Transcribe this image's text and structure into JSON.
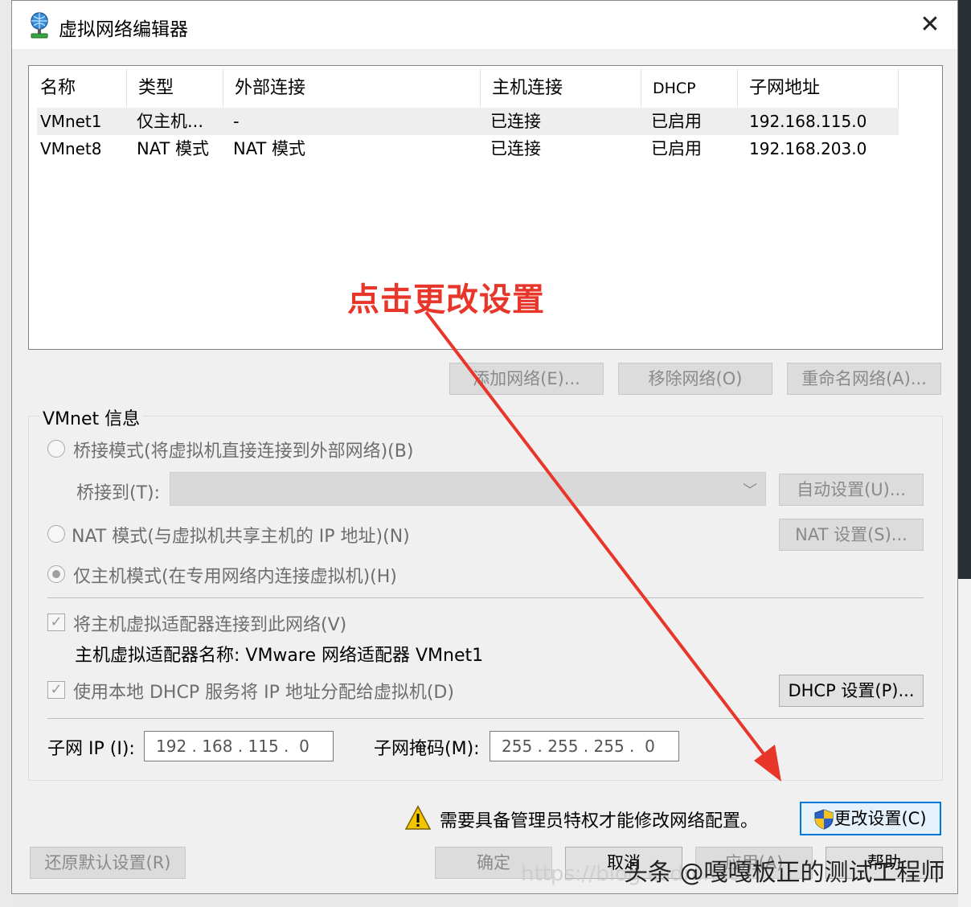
{
  "window": {
    "title": "虚拟网络编辑器",
    "close_glyph": "✕"
  },
  "table": {
    "headers": [
      "名称",
      "类型",
      "外部连接",
      "主机连接",
      "DHCP",
      "子网地址"
    ],
    "rows": [
      [
        "VMnet1",
        "仅主机...",
        "-",
        "已连接",
        "已启用",
        "192.168.115.0"
      ],
      [
        "VMnet8",
        "NAT 模式",
        "NAT 模式",
        "已连接",
        "已启用",
        "192.168.203.0"
      ]
    ]
  },
  "network_buttons": {
    "add": "添加网络(E)...",
    "remove": "移除网络(O)",
    "rename": "重命名网络(A)..."
  },
  "vmnet_info": {
    "group_label": "VMnet 信息",
    "bridged_mode": "桥接模式(将虚拟机直接连接到外部网络)(B)",
    "bridged_to_label": "桥接到(T):",
    "auto_settings": "自动设置(U)...",
    "nat_mode": "NAT 模式(与虚拟机共享主机的 IP 地址)(N)",
    "nat_settings": "NAT 设置(S)...",
    "host_only_mode": "仅主机模式(在专用网络内连接虚拟机)(H)",
    "connect_adapter": "将主机虚拟适配器连接到此网络(V)",
    "adapter_name": "主机虚拟适配器名称: VMware 网络适配器 VMnet1",
    "use_dhcp": "使用本地 DHCP 服务将 IP 地址分配给虚拟机(D)",
    "dhcp_settings": "DHCP 设置(P)...",
    "subnet_ip_label": "子网 IP (I):",
    "subnet_ip_value": "192 . 168 . 115 .  0",
    "subnet_mask_label": "子网掩码(M):",
    "subnet_mask_value": "255 . 255 . 255 .  0"
  },
  "admin_notice": "需要具备管理员特权才能修改网络配置。",
  "change_settings": "更改设置(C)",
  "bottom_buttons": {
    "restore": "还原默认设置(R)",
    "ok": "确定",
    "cancel": "取消",
    "apply": "应用(A)",
    "help": "帮助"
  },
  "annotation": {
    "text": "点击更改设置",
    "color": "#e8362b"
  },
  "watermark": {
    "text": "头条 @嘎嘎板正的测试工程师",
    "ghost": "https://blog.csdn.net"
  },
  "colors": {
    "accent": "#0078d7",
    "dialog_bg": "#f0f0f0",
    "warning": "#f5c400"
  }
}
